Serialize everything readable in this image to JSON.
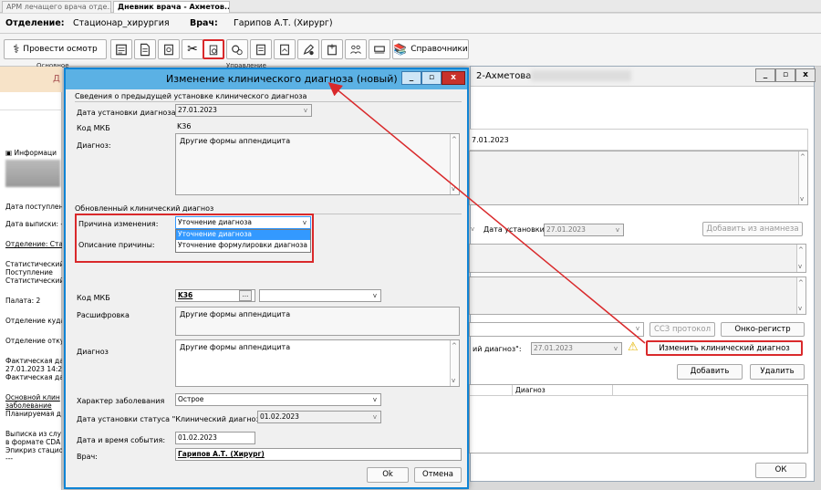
{
  "tabs": [
    "АРМ лечащего врача отде..",
    "Дневник врача - Ахметов.."
  ],
  "header": {
    "dept_label": "Отделение:",
    "dept_value": "Стационар_хирургия",
    "doctor_label": "Врач:",
    "doctor_value": "Гарипов А.Т. (Хирург)"
  },
  "toolbar": {
    "exam_button": "Провести осмотр",
    "references_button": "Справочники",
    "group_main": "Основное",
    "group_manage": "Управление"
  },
  "left_panel": {
    "header_partial": "Д",
    "info_label": "Информаци",
    "admit_date": "Дата поступлен",
    "discharge_date": "Дата выписки: -",
    "department_link": "Отделение: Ста",
    "stat_1": "Статистический",
    "stat_2": "Поступление",
    "stat_3": "Статистический",
    "ward": "Палата: 2",
    "dept_from": "Отделение куда",
    "dept_to": "Отделение отку",
    "actual_1": "Фактическая да",
    "actual_2": "27.01.2023 14:26",
    "actual_3": "Фактическая да",
    "main_diag": "Основной клин",
    "disease": "заболевание",
    "planned": "Планируемая д",
    "extract_1": "Выписка из слу",
    "extract_2": "в формате CDA",
    "extract_3": "Эпикриз стацио",
    "extract_4": "---"
  },
  "bg_window": {
    "title": "2-Ахметова",
    "date_partial": "7.01.2023",
    "date_set_label": "Дата установки",
    "date_set_value": "27.01.2023",
    "add_from_anamnesis": "Добавить из анамнеза",
    "ssz_protocol": "ССЗ протокол",
    "onco_register": "Онко-регистр",
    "clinical_diag_label": "ий диагноз\":",
    "clinical_diag_date": "27.01.2023",
    "change_diag_button": "Изменить клинический диагноз",
    "add_button": "Добавить",
    "delete_button": "Удалить",
    "table_col": "Диагноз",
    "ok_button": "ОК"
  },
  "dialog": {
    "title": "Изменение клинического диагноза (новый)",
    "prev_section": "Сведения о предыдущей установке клинического диагноза",
    "prev_date_label": "Дата установки диагноза",
    "prev_date_value": "27.01.2023",
    "mkb_label": "Код МКБ",
    "mkb_value": "K36",
    "diag_label": "Диагноз:",
    "diag_value": "Другие формы аппендицита",
    "new_section": "Обновленный клинический диагноз",
    "reason_label": "Причина изменения:",
    "reason_value": "Уточнение диагноза",
    "reason_options": [
      "Уточнение диагноза",
      "Уточнение формулировки диагноза"
    ],
    "reason_desc_label": "Описание причины:",
    "mkb2_label": "Код МКБ",
    "mkb2_value": "K36",
    "decode_label": "Расшифровка",
    "decode_value": "Другие формы аппендицита",
    "diag2_label": "Диагноз",
    "diag2_value": "Другие формы аппендицита",
    "character_label": "Характер заболевания",
    "character_value": "Острое",
    "status_date_label": "Дата установки статуса \"Клинический диагноз\":",
    "status_date_value": "01.02.2023",
    "event_label": "Дата и время события:",
    "event_value": "01.02.2023",
    "doctor_label": "Врач:",
    "doctor_value": "Гарипов А.Т. (Хирург)",
    "ok_button": "Ok",
    "cancel_button": "Отмена"
  },
  "colors": {
    "accent": "#0f84d5",
    "dialog_title": "#5bb1e4",
    "highlight": "#d9292b",
    "selection": "#3399ff"
  }
}
